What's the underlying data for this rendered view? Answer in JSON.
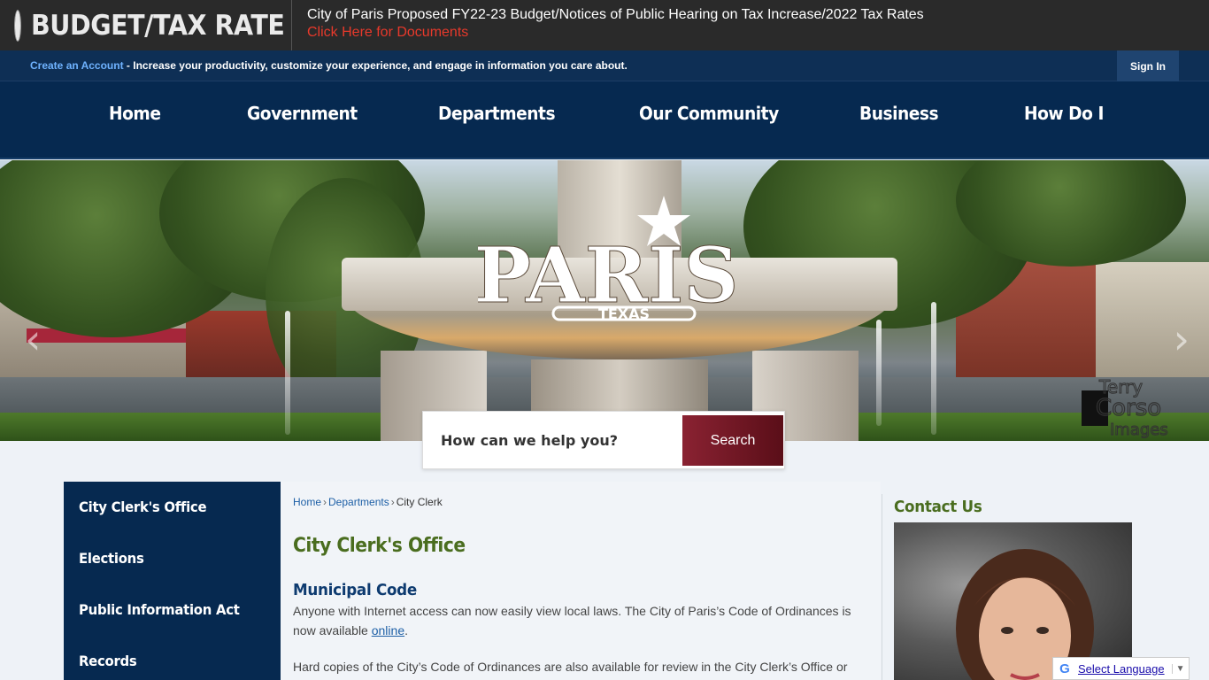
{
  "alert": {
    "title": "BUDGET/TAX RATE",
    "headline": "City of Paris Proposed FY22-23 Budget/Notices of Public Hearing on Tax Increase/2022 Tax Rates",
    "link": "Click Here for Documents"
  },
  "account_bar": {
    "create_link": "Create an Account",
    "message": " - Increase your productivity, customize your experience, and engage in information you care about.",
    "sign_in": "Sign In"
  },
  "nav": {
    "items": [
      "Home",
      "Government",
      "Departments",
      "Our Community",
      "Business",
      "How Do I"
    ]
  },
  "hero": {
    "logo_main": "PARIS",
    "logo_sub": "TEXAS",
    "arrow_left": "‹",
    "arrow_right": "›",
    "watermark_1": "Terry",
    "watermark_2": "Corso",
    "watermark_3": "Images"
  },
  "search": {
    "placeholder": "How can we help you?",
    "button": "Search"
  },
  "sidebar": {
    "items": [
      "City Clerk's Office",
      "Elections",
      "Public Information Act",
      "Records"
    ]
  },
  "breadcrumb": {
    "items": [
      "Home",
      "Departments",
      "City Clerk"
    ],
    "separator": "›"
  },
  "content": {
    "page_title": "City Clerk's Office",
    "section_title": "Municipal Code",
    "para1_before": "Anyone with Internet access can now easily view local laws. The City of Paris’s Code of Ordinances is now available ",
    "para1_link": "online",
    "para1_after": ".",
    "para2": "Hard copies of the City’s Code of Ordinances are also available for review in the City Clerk’s Office or"
  },
  "contact": {
    "title": "Contact Us"
  },
  "translate": {
    "g": "G",
    "label": "Select Language",
    "arrow": "▼"
  },
  "colors": {
    "alert_bg": "#2a2a2a",
    "alert_link": "#e8392b",
    "nav_bg": "#062950",
    "title_green": "#4a6d1f",
    "section_blue": "#0e3b70",
    "search_button": "#7a1a28"
  },
  "icons": {
    "alert": "red-alert-dot-icon",
    "google": "google-g-icon"
  }
}
